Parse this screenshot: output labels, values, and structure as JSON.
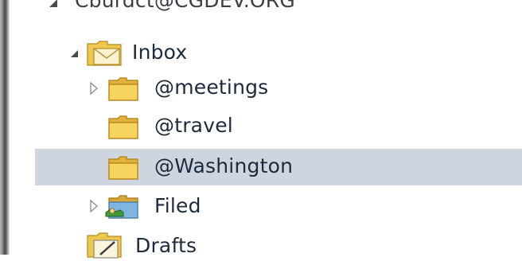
{
  "window": {
    "pane": "folder-tree"
  },
  "tree": {
    "account": {
      "label": "Cburdct@CGDEV.ORG",
      "expander": "expanded"
    },
    "inbox": {
      "label": "Inbox",
      "icon": "inbox-envelope-icon",
      "expander": "expanded"
    },
    "meetings": {
      "label": "@meetings",
      "icon": "folder-icon",
      "expander": "collapsed"
    },
    "travel": {
      "label": "@travel",
      "icon": "folder-icon"
    },
    "washington": {
      "label": "@Washington",
      "icon": "folder-icon",
      "selected": true
    },
    "filed": {
      "label": "Filed",
      "icon": "shared-folder-icon",
      "expander": "collapsed"
    },
    "drafts": {
      "label": "Drafts",
      "icon": "drafts-icon"
    }
  },
  "colors": {
    "selection": "#cfd5df",
    "folder": "#f6d25a",
    "text": "#1d2a3d"
  }
}
